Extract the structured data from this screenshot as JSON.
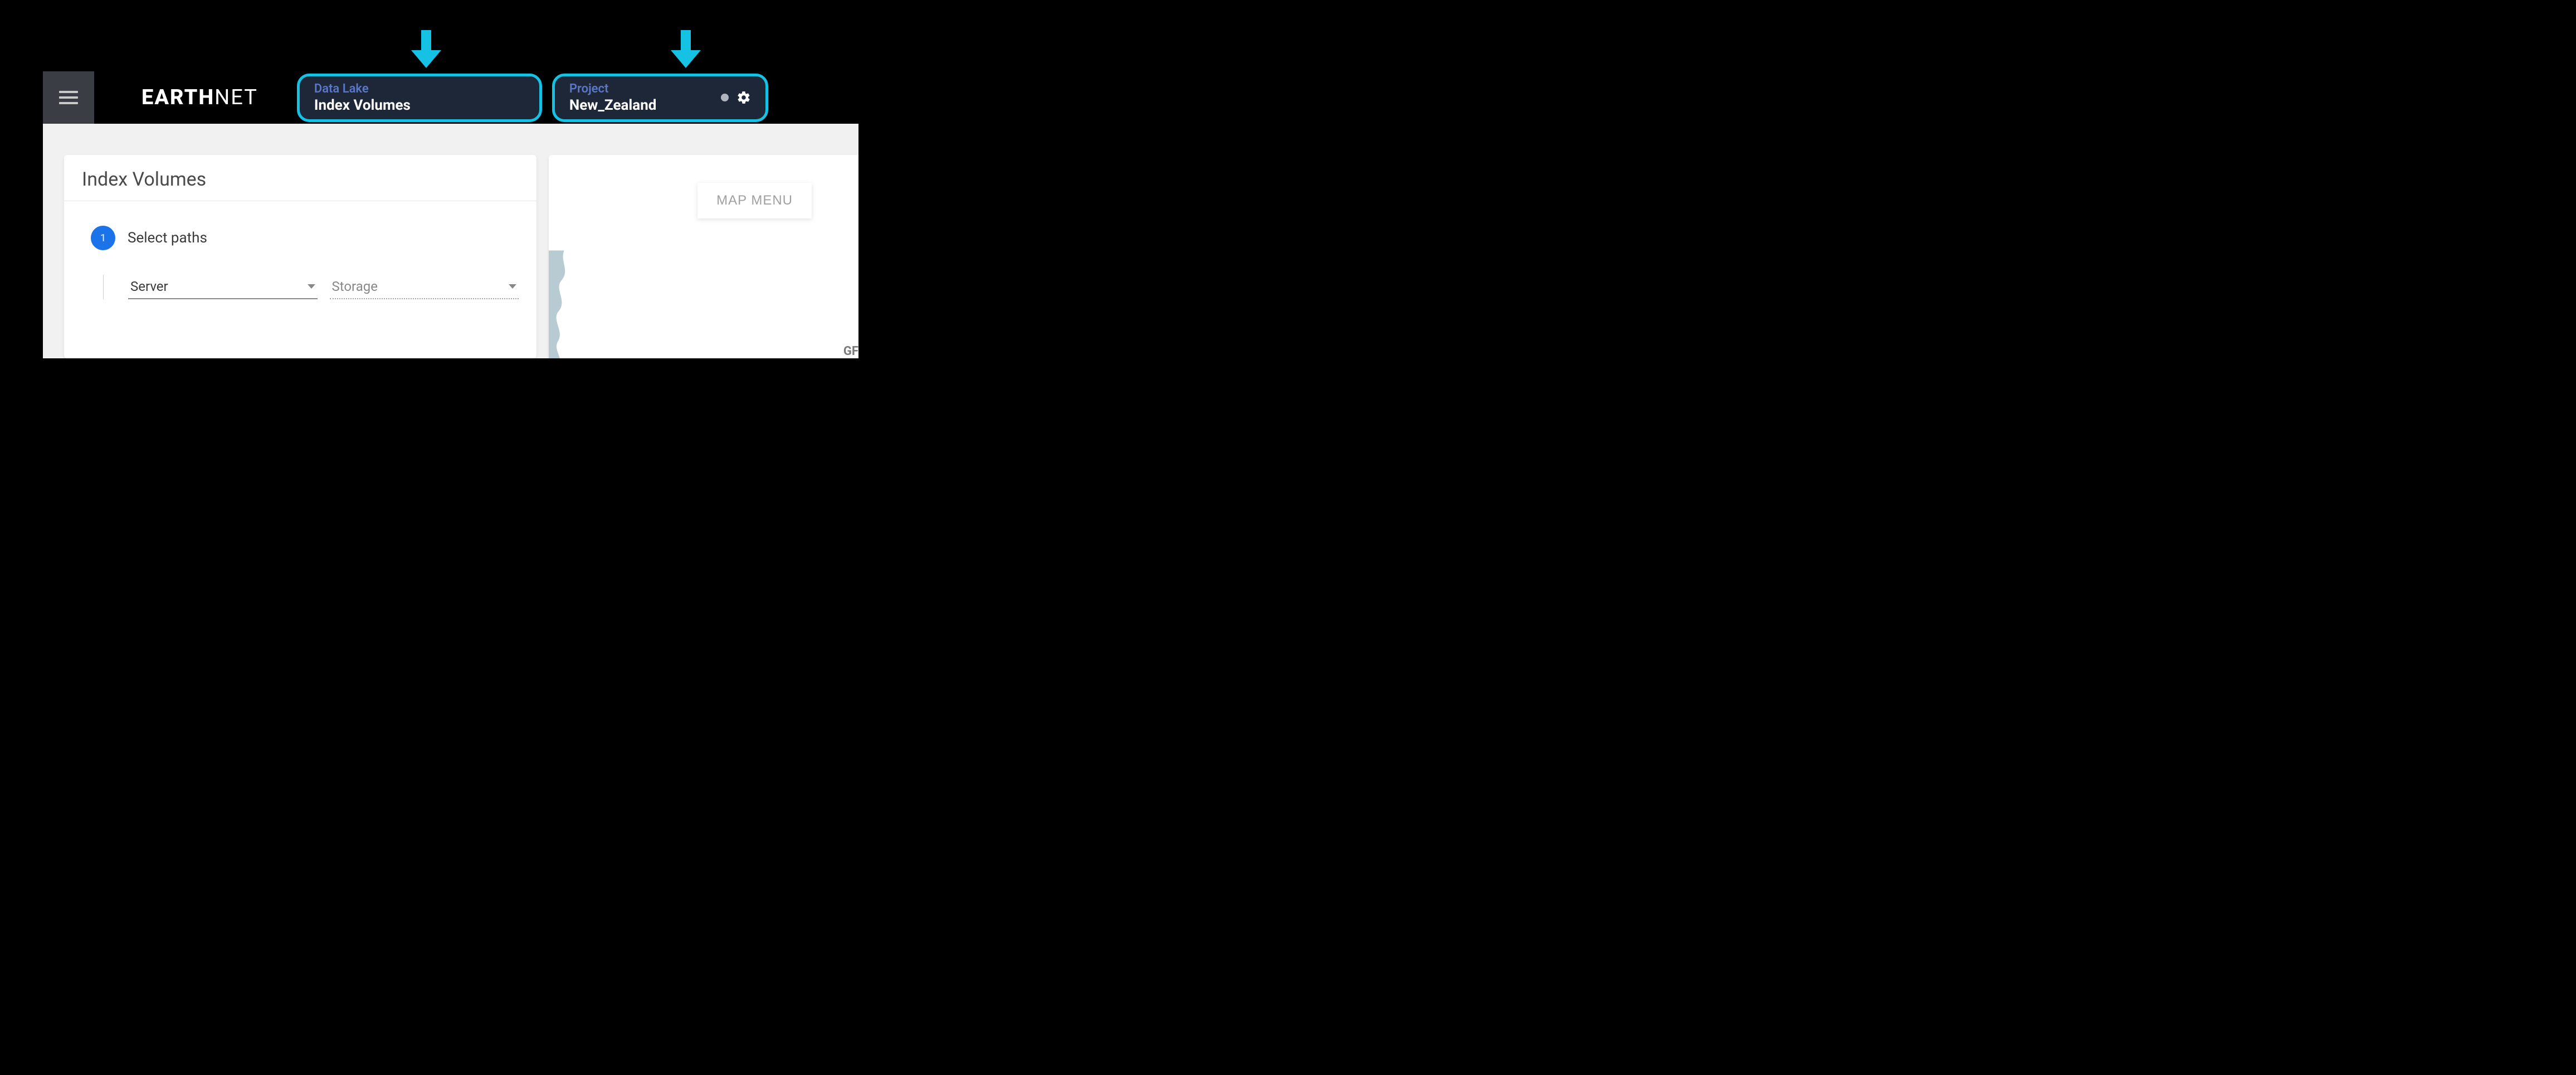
{
  "brand": {
    "bold": "EARTH",
    "light": "NET"
  },
  "header": {
    "datalake": {
      "label": "Data Lake",
      "value": "Index Volumes"
    },
    "project": {
      "label": "Project",
      "value": "New_Zealand"
    }
  },
  "card": {
    "title": "Index Volumes",
    "step_number": "1",
    "step_label": "Select paths",
    "server_label": "Server",
    "storage_label": "Storage"
  },
  "map": {
    "menu_label": "MAP MENU",
    "attribution_partial": "GF"
  }
}
